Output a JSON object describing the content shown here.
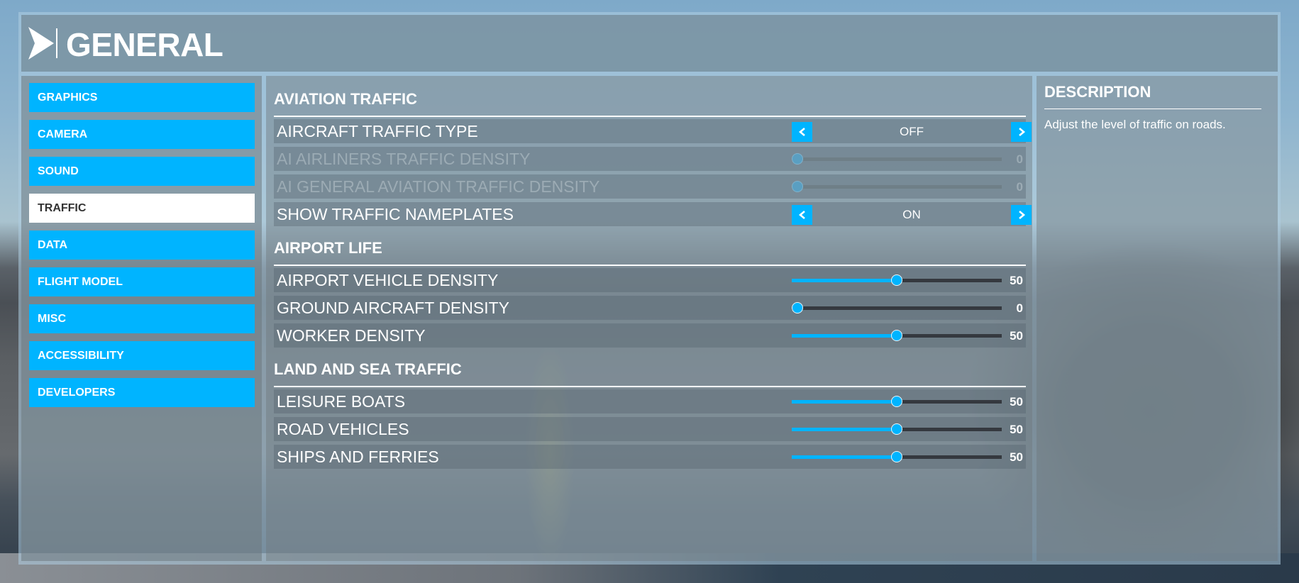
{
  "header": {
    "title": "GENERAL",
    "logo_icon": "arrow-logo-icon"
  },
  "sidebar": {
    "items": [
      {
        "label": "GRAPHICS",
        "active": false
      },
      {
        "label": "CAMERA",
        "active": false
      },
      {
        "label": "SOUND",
        "active": false
      },
      {
        "label": "TRAFFIC",
        "active": true
      },
      {
        "label": "DATA",
        "active": false
      },
      {
        "label": "FLIGHT MODEL",
        "active": false
      },
      {
        "label": "MISC",
        "active": false
      },
      {
        "label": "ACCESSIBILITY",
        "active": false
      },
      {
        "label": "DEVELOPERS",
        "active": false
      }
    ]
  },
  "sections": [
    {
      "title": "AVIATION TRAFFIC",
      "rows": [
        {
          "label": "AIRCRAFT TRAFFIC TYPE",
          "type": "toggle",
          "value": "OFF",
          "disabled": false
        },
        {
          "label": "AI AIRLINERS TRAFFIC DENSITY",
          "type": "slider",
          "value": 0,
          "min": 0,
          "max": 100,
          "disabled": true
        },
        {
          "label": "AI GENERAL AVIATION TRAFFIC DENSITY",
          "type": "slider",
          "value": 0,
          "min": 0,
          "max": 100,
          "disabled": true
        },
        {
          "label": "SHOW TRAFFIC NAMEPLATES",
          "type": "toggle",
          "value": "ON",
          "disabled": false
        }
      ]
    },
    {
      "title": "AIRPORT LIFE",
      "rows": [
        {
          "label": "AIRPORT VEHICLE DENSITY",
          "type": "slider",
          "value": 50,
          "min": 0,
          "max": 100,
          "disabled": false
        },
        {
          "label": "GROUND AIRCRAFT DENSITY",
          "type": "slider",
          "value": 0,
          "min": 0,
          "max": 100,
          "disabled": false
        },
        {
          "label": "WORKER DENSITY",
          "type": "slider",
          "value": 50,
          "min": 0,
          "max": 100,
          "disabled": false
        }
      ]
    },
    {
      "title": "LAND AND SEA TRAFFIC",
      "rows": [
        {
          "label": "LEISURE BOATS",
          "type": "slider",
          "value": 50,
          "min": 0,
          "max": 100,
          "disabled": false
        },
        {
          "label": "ROAD VEHICLES",
          "type": "slider",
          "value": 50,
          "min": 0,
          "max": 100,
          "disabled": false
        },
        {
          "label": "SHIPS AND FERRIES",
          "type": "slider",
          "value": 50,
          "min": 0,
          "max": 100,
          "disabled": false
        }
      ]
    }
  ],
  "description": {
    "title": "DESCRIPTION",
    "text": "Adjust the level of traffic on roads."
  },
  "colors": {
    "accent": "#00b4ff",
    "active_nav_bg": "#ffffff",
    "active_nav_text": "#333333",
    "text": "#ffffff"
  }
}
